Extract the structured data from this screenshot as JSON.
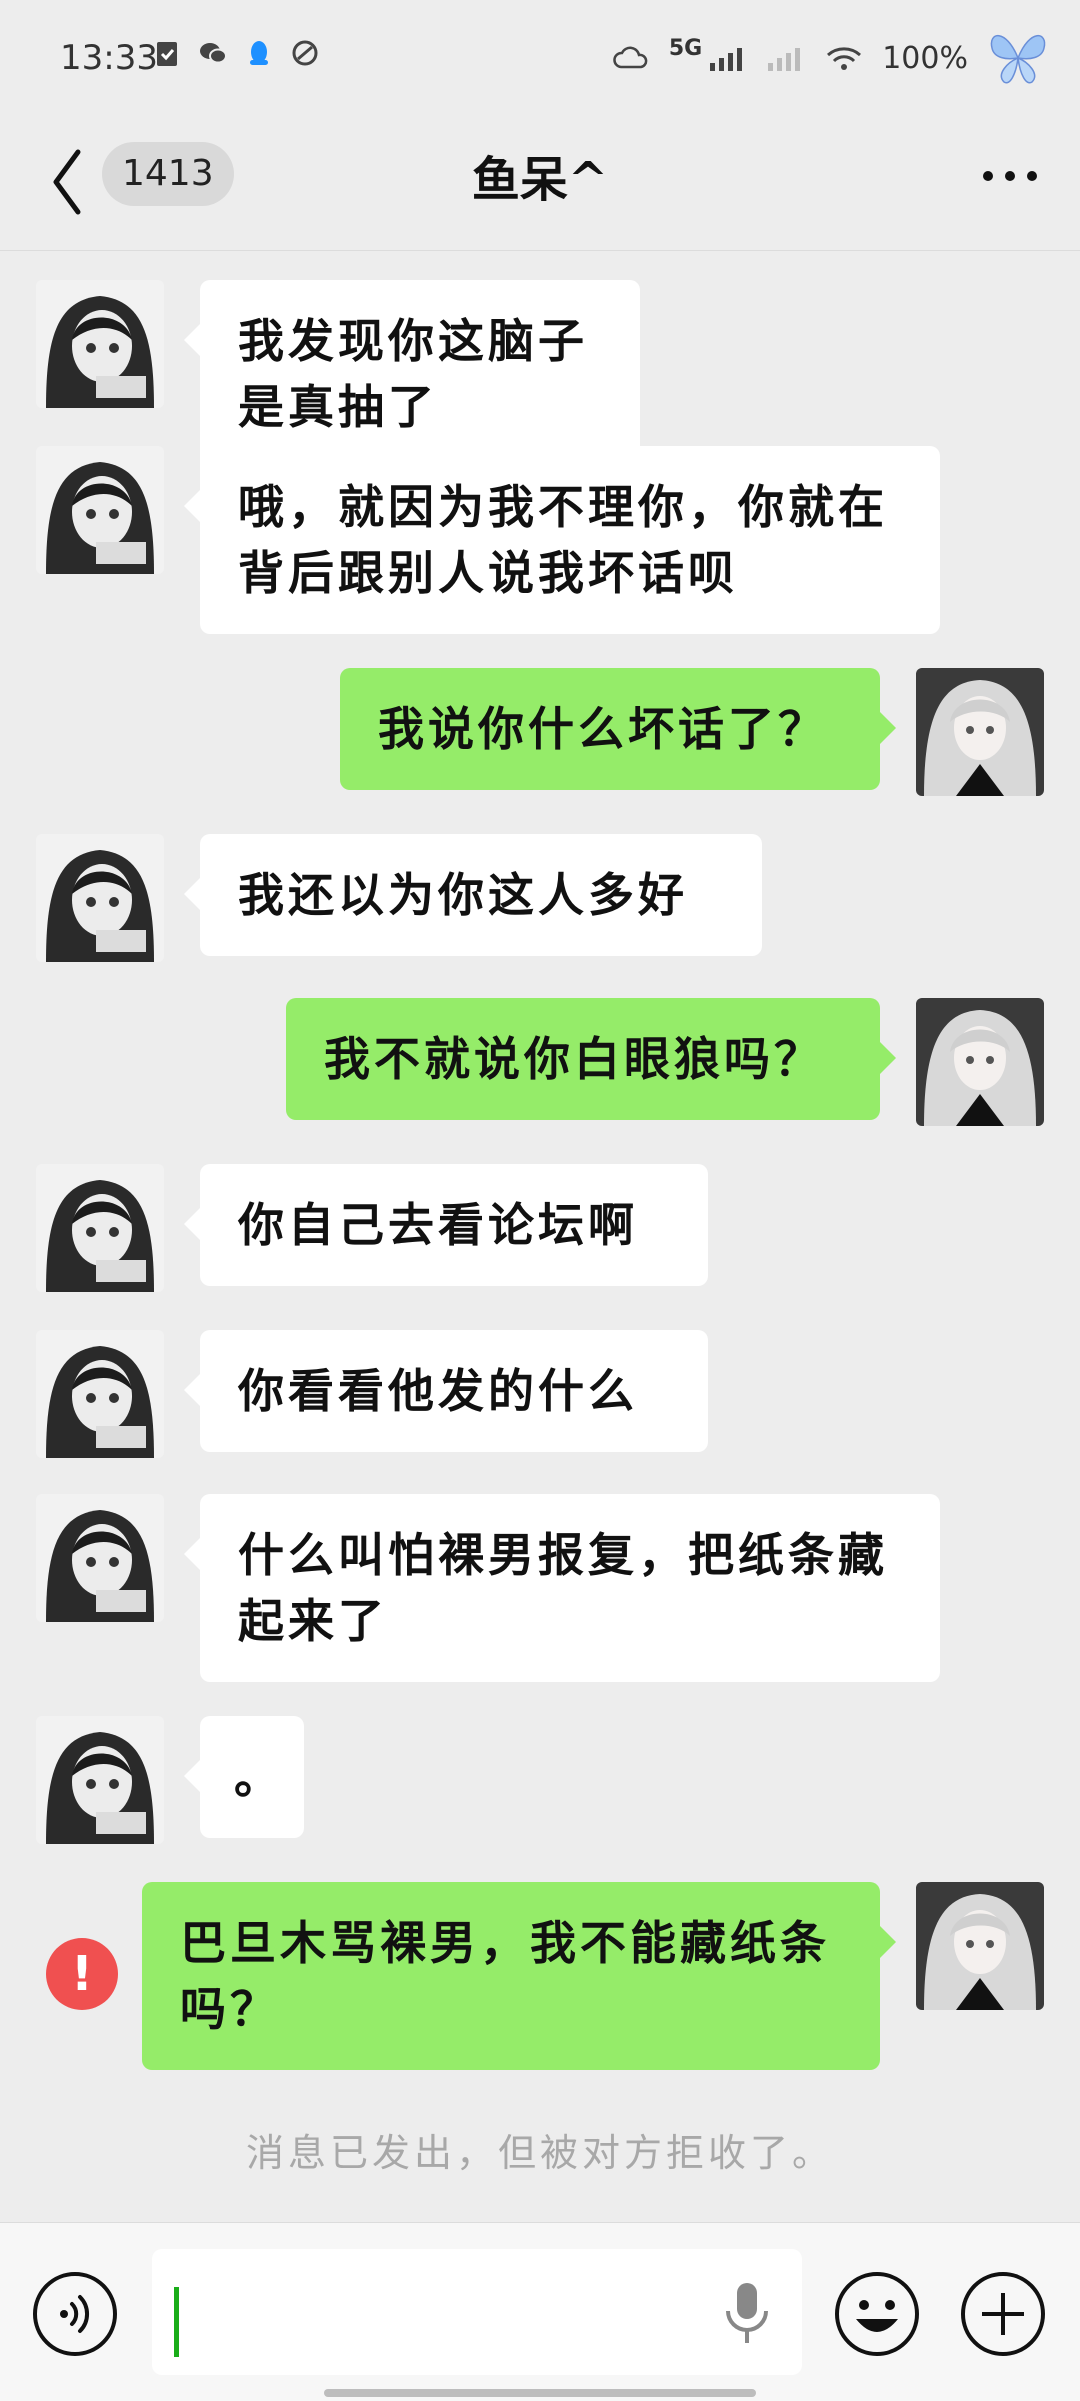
{
  "status_bar": {
    "time": "13:33",
    "network": "5G",
    "battery": "100%",
    "left_icons": [
      "clipboard-icon",
      "wechat-icon",
      "qq-icon",
      "link-icon"
    ]
  },
  "header": {
    "unread_count": "1413",
    "title": "鱼呆^"
  },
  "messages": [
    {
      "side": "in",
      "text": "我发现你这脑子是真抽了"
    },
    {
      "side": "in",
      "text": "哦，就因为我不理你，你就在背后跟别人说我坏话呗"
    },
    {
      "side": "out",
      "text": "我说你什么坏话了？"
    },
    {
      "side": "in",
      "text": "我还以为你这人多好"
    },
    {
      "side": "out",
      "text": "我不就说你白眼狼吗？"
    },
    {
      "side": "in",
      "text": "你自己去看论坛啊"
    },
    {
      "side": "in",
      "text": "你看看他发的什么"
    },
    {
      "side": "in",
      "text": "什么叫怕裸男报复，把纸条藏起来了"
    },
    {
      "side": "in",
      "text": "。"
    },
    {
      "side": "out",
      "text": "巴旦木骂裸男，我不能藏纸条吗？",
      "failed": true
    }
  ],
  "system_note": "消息已发出，但被对方拒收了。",
  "colors": {
    "outgoing_bubble": "#95ec69",
    "incoming_bubble": "#ffffff",
    "error": "#f05050",
    "background": "#ededed"
  }
}
